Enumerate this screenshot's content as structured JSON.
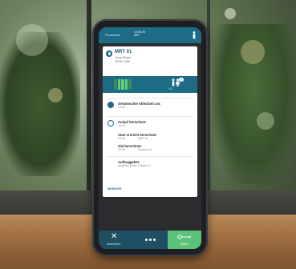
{
  "status": {
    "logo": "Pleasecall",
    "time_line1": "13:56:26",
    "time_line2": "MIH"
  },
  "job": {
    "title": "MRT 01",
    "patient": "Jung-Bürger",
    "date": "15.06.1989"
  },
  "banner": {
    "badge": "2",
    "people_label": "1/2"
  },
  "details": {
    "pickup_label": "Gewünschte Abholzeit um:",
    "pickup_value": "14:00",
    "arrival_label": "Anlauf berechnet:",
    "arrival_value": "14:10",
    "start_label": "Start erreicht berechnet:",
    "start_time": "14:20",
    "start_place": "MRT 01",
    "goal_label": "Ziel berechnet:",
    "goal_time": "14:30",
    "goal_place": "Zimmer 04",
    "client_label": "Auftraggeber:",
    "client_value": "Angelika Meier | Station 1",
    "more_link": "WENIGER"
  },
  "footer": {
    "cancel_label": "Abbrechen",
    "next_label": "Weiter"
  },
  "colors": {
    "primary": "#1e6b86",
    "accent_green": "#5bc27a"
  },
  "icons": {
    "status": "person-icon",
    "job": "location-pin-icon",
    "pickup": "chat-icon",
    "timeline": "clock-icon",
    "people": "people-icon",
    "cancel": "close-icon",
    "next": "arrow-right-icon"
  }
}
